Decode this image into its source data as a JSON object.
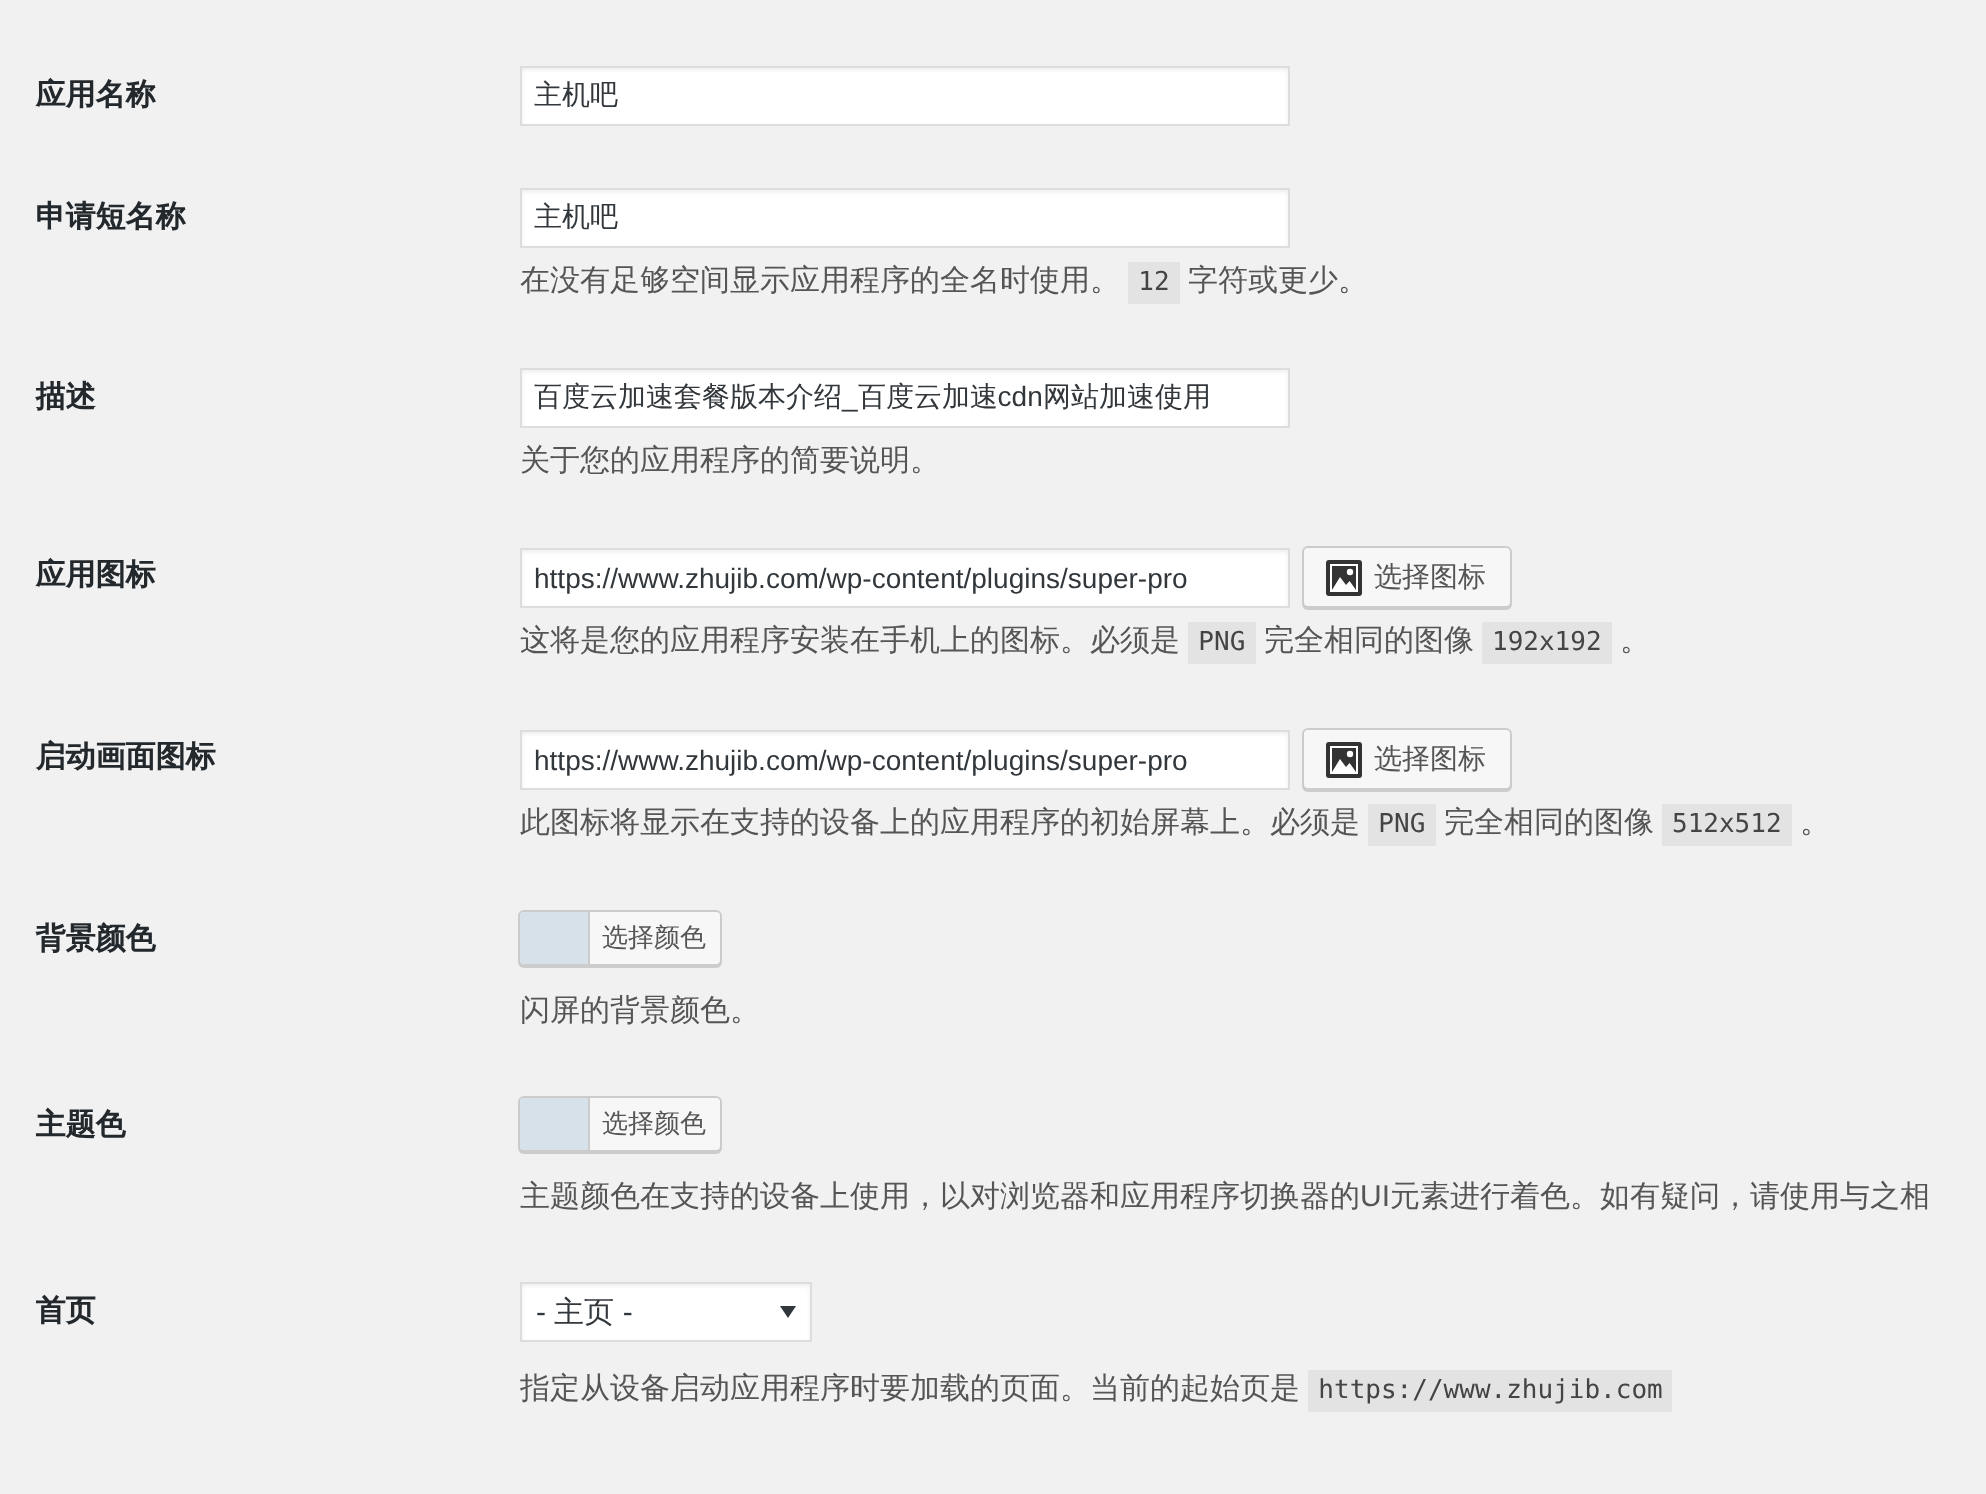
{
  "fields": [
    {
      "kind": "text",
      "label": "应用名称",
      "value": "主机吧"
    },
    {
      "kind": "text",
      "label": "申请短名称",
      "value": "主机吧",
      "description": [
        {
          "kind": "text",
          "text": "在没有足够空间显示应用程序的全名时使用。"
        },
        {
          "kind": "code",
          "text": "12"
        },
        {
          "kind": "text",
          "text": "字符或更少。"
        }
      ]
    },
    {
      "kind": "text",
      "label": "描述",
      "value": "百度云加速套餐版本介绍_百度云加速cdn网站加速使用",
      "description": [
        {
          "kind": "text",
          "text": "关于您的应用程序的简要说明。"
        }
      ]
    },
    {
      "kind": "image",
      "label": "应用图标",
      "value": "https://www.zhujib.com/wp-content/plugins/super-pro",
      "button": "选择图标",
      "description": [
        {
          "kind": "text",
          "text": "这将是您的应用程序安装在手机上的图标。必须是"
        },
        {
          "kind": "code",
          "text": "PNG"
        },
        {
          "kind": "text",
          "text": "完全相同的图像"
        },
        {
          "kind": "code",
          "text": "192x192"
        },
        {
          "kind": "text",
          "text": "。"
        }
      ]
    },
    {
      "kind": "image",
      "label": "启动画面图标",
      "value": "https://www.zhujib.com/wp-content/plugins/super-pro",
      "button": "选择图标",
      "description": [
        {
          "kind": "text",
          "text": "此图标将显示在支持的设备上的应用程序的初始屏幕上。必须是"
        },
        {
          "kind": "code",
          "text": "PNG"
        },
        {
          "kind": "text",
          "text": "完全相同的图像"
        },
        {
          "kind": "code",
          "text": "512x512"
        },
        {
          "kind": "text",
          "text": "。"
        }
      ]
    },
    {
      "kind": "color",
      "label": "背景颜色",
      "color": "#d7e1ea",
      "button": "选择颜色",
      "description": [
        {
          "kind": "text",
          "text": "闪屏的背景颜色。"
        }
      ]
    },
    {
      "kind": "color",
      "label": "主题色",
      "color": "#d7e1ea",
      "button": "选择颜色",
      "description": [
        {
          "kind": "text",
          "text": "主题颜色在支持的设备上使用，以对浏览器和应用程序切换器的UI元素进行着色。如有疑问，请使用与之相"
        }
      ]
    },
    {
      "kind": "select",
      "label": "首页",
      "value": "- 主页 -",
      "description": [
        {
          "kind": "text",
          "text": "指定从设备启动应用程序时要加载的页面。当前的起始页是"
        },
        {
          "kind": "code",
          "text": "https://www.zhujib.com"
        }
      ]
    }
  ]
}
